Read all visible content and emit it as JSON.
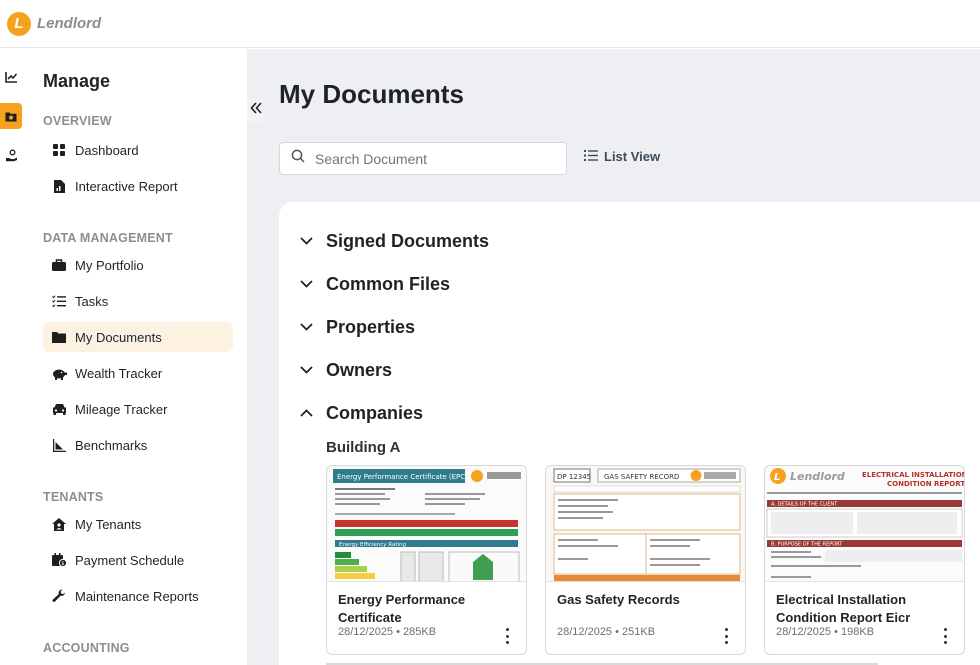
{
  "app": {
    "brand": "Lendlord",
    "logo_letter": "L",
    "accent": "#f6a21e"
  },
  "rail": [
    {
      "icon": "chart-icon"
    },
    {
      "icon": "folder-icon",
      "active": true
    },
    {
      "icon": "hand-coin-icon"
    }
  ],
  "sidebar": {
    "title": "Manage",
    "sections": {
      "overview": "OVERVIEW",
      "data_management": "DATA MANAGEMENT",
      "tenants": "TENANTS",
      "accounting": "ACCOUNTING"
    },
    "items": {
      "dashboard": "Dashboard",
      "interactive_report": "Interactive Report",
      "my_portfolio": "My Portfolio",
      "tasks": "Tasks",
      "my_documents": "My Documents",
      "wealth_tracker": "Wealth Tracker",
      "mileage_tracker": "Mileage Tracker",
      "benchmarks": "Benchmarks",
      "my_tenants": "My Tenants",
      "payment_schedule": "Payment Schedule",
      "maintenance_reports": "Maintenance Reports"
    }
  },
  "main": {
    "title": "My Documents",
    "search_placeholder": "Search Document",
    "list_view_label": "List View",
    "accordions": {
      "signed": "Signed Documents",
      "common": "Common Files",
      "properties": "Properties",
      "owners": "Owners",
      "companies": "Companies"
    },
    "subhead": "Building A",
    "cards": [
      {
        "title": "Energy Performance Certificate",
        "meta": "28/12/2025 • 285KB"
      },
      {
        "title": "Gas Safety Records",
        "meta": "28/12/2025 • 251KB"
      },
      {
        "title": "Electrical Installation Condition Report Eicr",
        "meta": "28/12/2025 • 198KB"
      }
    ],
    "thumbs": {
      "epc_header": "Energy Performance Certificate (EPC)",
      "epc_rating": "Energy Efficiency Rating",
      "gas_ref": "DP 12345",
      "gas_header": "GAS SAFETY RECORD",
      "eicr_header_1": "ELECTRICAL INSTALLATION",
      "eicr_header_2": "CONDITION REPORT",
      "eicr_client": "A. DETAILS OF THE CLIENT",
      "eicr_purpose": "B. PURPOSE OF THE REPORT"
    }
  }
}
